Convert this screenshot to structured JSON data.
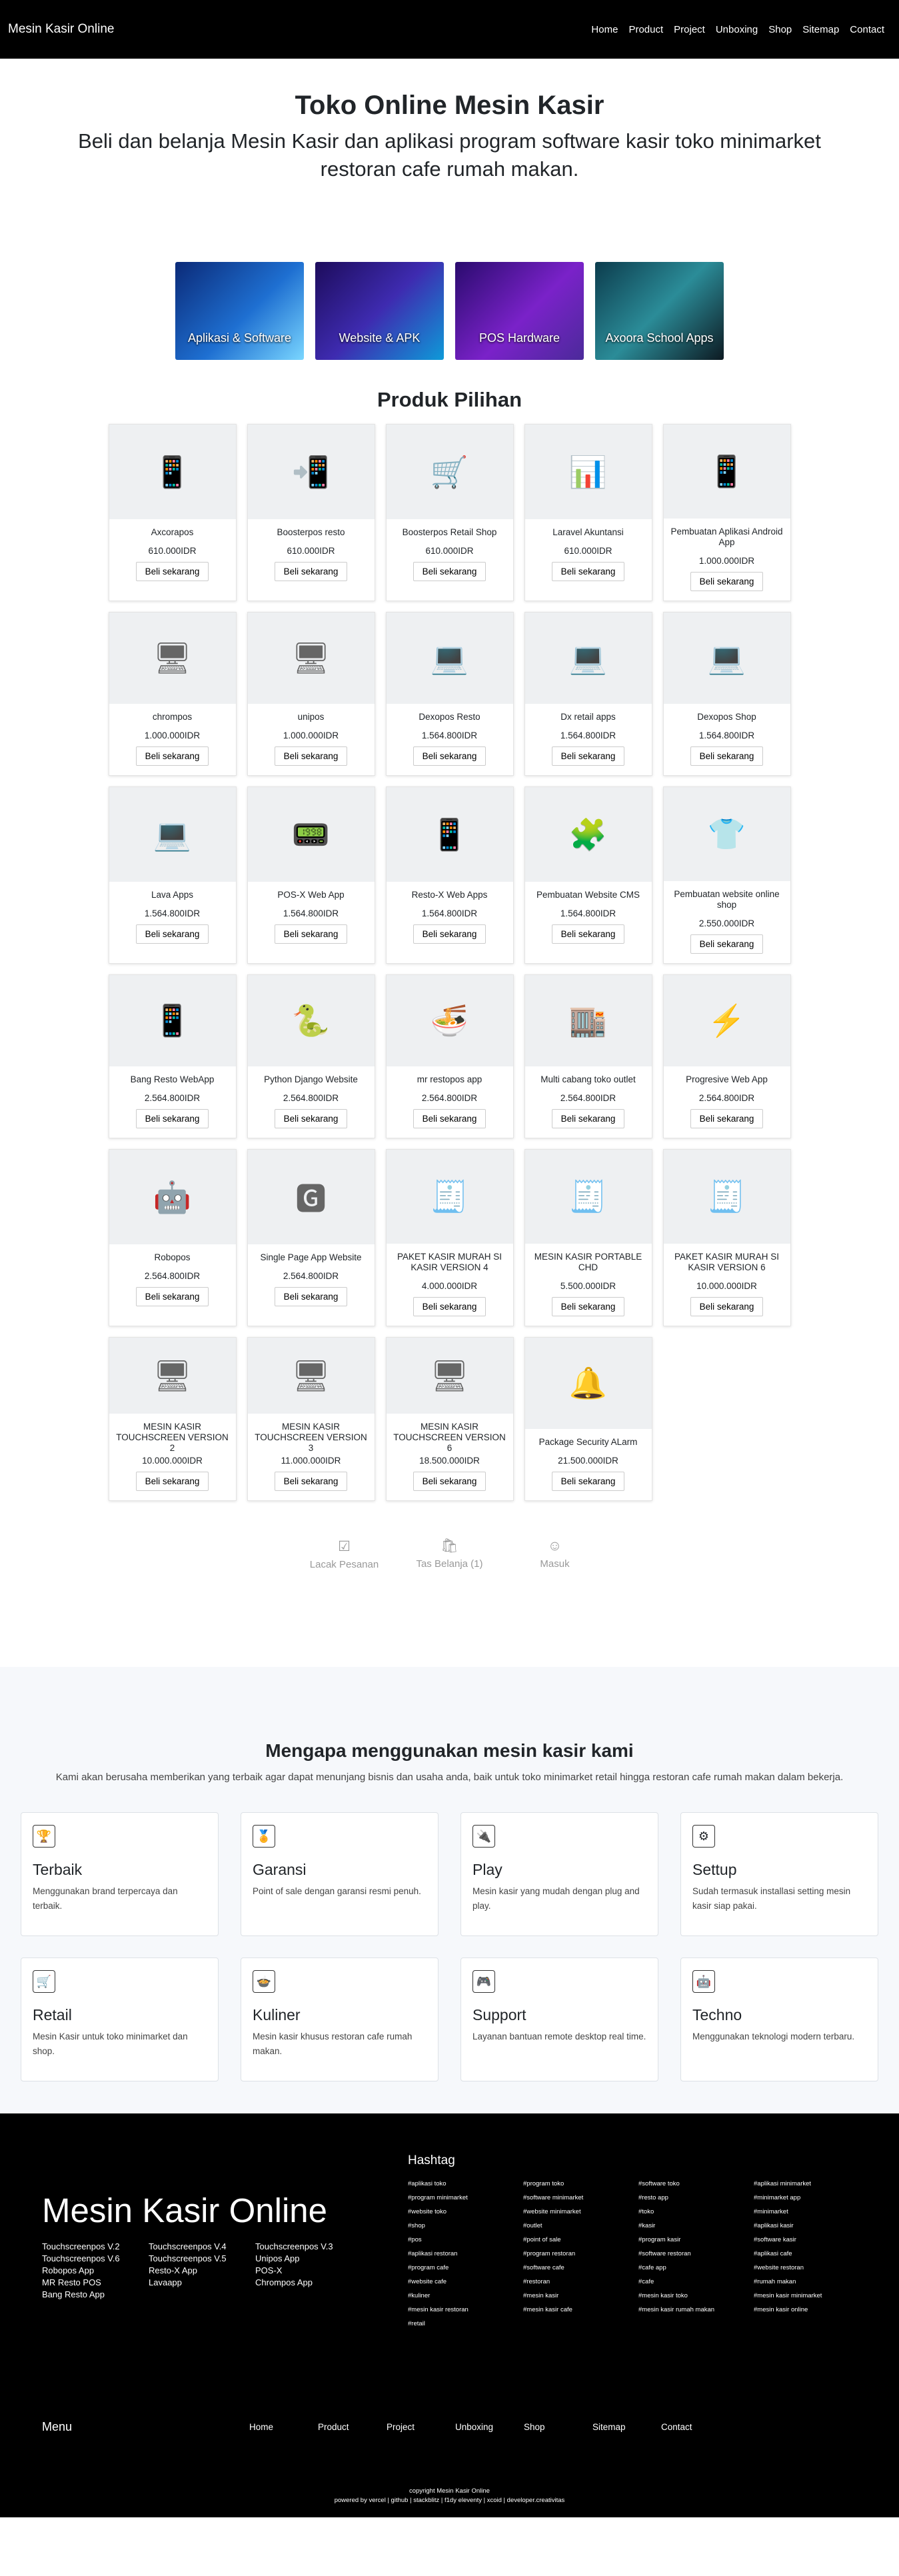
{
  "nav": {
    "brand": "Mesin Kasir Online",
    "items": [
      "Home",
      "Product",
      "Project",
      "Unboxing",
      "Shop",
      "Sitemap",
      "Contact"
    ]
  },
  "hero": {
    "title": "Toko Online Mesin Kasir",
    "subtitle": "Beli dan belanja Mesin Kasir dan aplikasi program software kasir toko minimarket restoran cafe rumah makan."
  },
  "categories": [
    "Aplikasi & Software",
    "Website & APK",
    "POS Hardware",
    "Axoora School Apps"
  ],
  "products_title": "Produk Pilihan",
  "buy_label": "Beli sekarang",
  "products": [
    {
      "name": "Axcorapos",
      "price": "610.000IDR"
    },
    {
      "name": "Boosterpos resto",
      "price": "610.000IDR"
    },
    {
      "name": "Boosterpos Retail Shop",
      "price": "610.000IDR"
    },
    {
      "name": "Laravel Akuntansi",
      "price": "610.000IDR"
    },
    {
      "name": "Pembuatan Aplikasi Android App",
      "price": "1.000.000IDR"
    },
    {
      "name": "chrompos",
      "price": "1.000.000IDR"
    },
    {
      "name": "unipos",
      "price": "1.000.000IDR"
    },
    {
      "name": "Dexopos Resto",
      "price": "1.564.800IDR"
    },
    {
      "name": "Dx retail apps",
      "price": "1.564.800IDR"
    },
    {
      "name": "Dexopos Shop",
      "price": "1.564.800IDR"
    },
    {
      "name": "Lava Apps",
      "price": "1.564.800IDR"
    },
    {
      "name": "POS-X Web App",
      "price": "1.564.800IDR"
    },
    {
      "name": "Resto-X Web Apps",
      "price": "1.564.800IDR"
    },
    {
      "name": "Pembuatan Website CMS",
      "price": "1.564.800IDR"
    },
    {
      "name": "Pembuatan website online shop",
      "price": "2.550.000IDR"
    },
    {
      "name": "Bang Resto WebApp",
      "price": "2.564.800IDR"
    },
    {
      "name": "Python Django Website",
      "price": "2.564.800IDR"
    },
    {
      "name": "mr restopos app",
      "price": "2.564.800IDR"
    },
    {
      "name": "Multi cabang toko outlet",
      "price": "2.564.800IDR"
    },
    {
      "name": "Progresive Web App",
      "price": "2.564.800IDR"
    },
    {
      "name": "Robopos",
      "price": "2.564.800IDR"
    },
    {
      "name": "Single Page App Website",
      "price": "2.564.800IDR"
    },
    {
      "name": "PAKET KASIR MURAH SI KASIR VERSION 4",
      "price": "4.000.000IDR"
    },
    {
      "name": "MESIN KASIR PORTABLE CHD",
      "price": "5.500.000IDR"
    },
    {
      "name": "PAKET KASIR MURAH SI KASIR VERSION 6",
      "price": "10.000.000IDR"
    },
    {
      "name": "MESIN KASIR TOUCHSCREEN VERSION 2",
      "price": "10.000.000IDR"
    },
    {
      "name": "MESIN KASIR TOUCHSCREEN VERSION 3",
      "price": "11.000.000IDR"
    },
    {
      "name": "MESIN KASIR TOUCHSCREEN VERSION 6",
      "price": "18.500.000IDR"
    },
    {
      "name": "Package Security ALarm",
      "price": "21.500.000IDR"
    }
  ],
  "tabs": [
    "Lacak Pesanan",
    "Tas Belanja (1)",
    "Masuk"
  ],
  "why": {
    "title": "Mengapa menggunakan mesin kasir kami",
    "lead": "Kami akan berusaha memberikan yang terbaik agar dapat menunjang bisnis dan usaha anda, baik untuk toko minimarket retail hingga restoran cafe rumah makan dalam bekerja.",
    "features": [
      {
        "title": "Terbaik",
        "text": "Menggunakan brand terpercaya dan terbaik.",
        "icon": "trophy-icon"
      },
      {
        "title": "Garansi",
        "text": "Point of sale dengan garansi resmi penuh.",
        "icon": "award-icon"
      },
      {
        "title": "Play",
        "text": "Mesin kasir yang mudah dengan plug and play.",
        "icon": "plug-icon"
      },
      {
        "title": "Settup",
        "text": "Sudah termasuk installasi setting mesin kasir siap pakai.",
        "icon": "gear-icon"
      },
      {
        "title": "Retail",
        "text": "Mesin Kasir untuk toko minimarket dan shop.",
        "icon": "cart-icon"
      },
      {
        "title": "Kuliner",
        "text": "Mesin kasir khusus restoran cafe rumah makan.",
        "icon": "cooking-pot-icon"
      },
      {
        "title": "Support",
        "text": "Layanan bantuan remote desktop real time.",
        "icon": "gamepad-icon"
      },
      {
        "title": "Techno",
        "text": "Menggunakan teknologi modern terbaru.",
        "icon": "robot-icon"
      }
    ]
  },
  "footer": {
    "title": "Mesin Kasir Online",
    "links": [
      "Touchscreenpos V.2",
      "Touchscreenpos V.4",
      "Touchscreenpos V.3",
      "Touchscreenpos V.6",
      "Touchscreenpos V.5",
      "Unipos App",
      "Robopos App",
      "Resto-X App",
      "POS-X",
      "MR Resto POS",
      "Lavaapp",
      "Chrompos App",
      "Bang Resto App"
    ],
    "hashtag_title": "Hashtag",
    "hashtags": [
      "#aplikasi toko",
      "#program toko",
      "#software toko",
      "#aplikasi minimarket",
      "#program minimarket",
      "#software minimarket",
      "#resto app",
      "#minimarket app",
      "#website toko",
      "#website minimarket",
      "#toko",
      "#minimarket",
      "#shop",
      "#outlet",
      "#kasir",
      "#aplikasi kasir",
      "#pos",
      "#point of sale",
      "#program kasir",
      "#software kasir",
      "#aplikasi restoran",
      "#program restoran",
      "#software restoran",
      "#aplikasi cafe",
      "#program cafe",
      "#software cafe",
      "#cafe app",
      "#website restoran",
      "#website cafe",
      "#restoran",
      "#cafe",
      "#rumah makan",
      "#kuliner",
      "#mesin kasir",
      "#mesin kasir toko",
      "#mesin kasir minimarket",
      "#mesin kasir restoran",
      "#mesin kasir cafe",
      "#mesin kasir rumah makan",
      "#mesin kasir online",
      "#retail"
    ],
    "menu_label": "Menu",
    "menu": [
      "Home",
      "Product",
      "Project",
      "Unboxing",
      "Shop",
      "Sitemap",
      "Contact"
    ],
    "copyright": "copyright Mesin Kasir Online",
    "powered": "powered by vercel | github | stackblitz | f1dy eleventy | xcoid | developer.creativitas"
  }
}
